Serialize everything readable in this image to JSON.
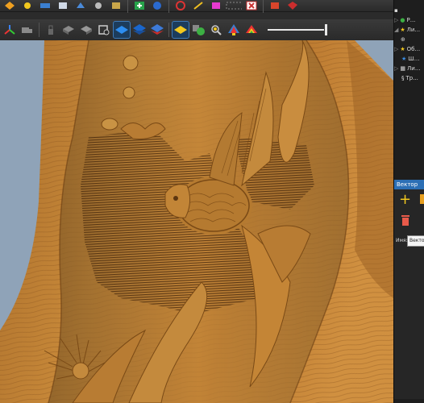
{
  "toolbar": {
    "row1_icons": [
      "orange-shape-icon",
      "yellow-star-icon",
      "layers-icon",
      "blue-cube-icon",
      "gears-icon",
      "stack-icon",
      "add-green-icon",
      "shield-blue-icon",
      "spiral-icon",
      "wand-icon",
      "magic-icon",
      "dashed-rect-icon",
      "close-red-icon",
      "paint-icon",
      "red-cube-icon"
    ],
    "row2_icons": [
      "axis-icon",
      "truck-icon",
      "lock-icon",
      "box-gray-icon",
      "box-gray2-icon",
      "tool-icon",
      "blue-plane-icon",
      "blue-layer-icon",
      "red-layer-icon",
      "yellow-diamond-icon",
      "green-circle-icon",
      "gear-zoom-icon",
      "shape-flag-icon",
      "rainbow-icon"
    ],
    "slider_value": 1.0
  },
  "tree": {
    "items": [
      {
        "label": "Р..."
      },
      {
        "label": "Ли..."
      },
      {
        "label": "Об..."
      },
      {
        "label": "Ш..."
      },
      {
        "label": "Ли..."
      },
      {
        "label": "Тр..."
      }
    ]
  },
  "vector_panel": {
    "header": "Вектор",
    "name_label": "Имя:",
    "name_value": "Векто"
  },
  "colors": {
    "accent": "#2c6fb5",
    "wood_light": "#c98a3a",
    "wood_dark": "#7a4a16"
  }
}
